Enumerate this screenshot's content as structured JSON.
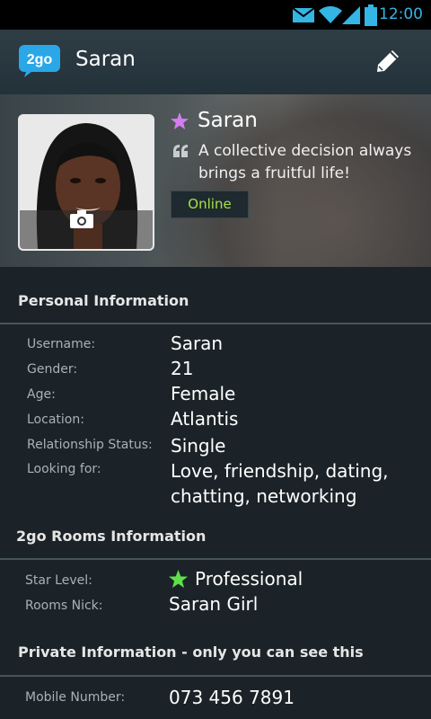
{
  "status_bar": {
    "time": "12:00",
    "icons": [
      "email-icon",
      "wifi-icon",
      "signal-icon",
      "battery-icon"
    ]
  },
  "app_bar": {
    "title": "Saran",
    "logo_text": "2go"
  },
  "profile": {
    "name": "Saran",
    "status_message": "A collective decision always brings a fruitful life!",
    "presence": "Online"
  },
  "personal": {
    "heading": "Personal Information",
    "rows": [
      {
        "label": "Username:",
        "value": "Saran"
      },
      {
        "label": "Gender:",
        "value": "21"
      },
      {
        "label": "Age:",
        "value": "Female"
      },
      {
        "label": "Location:",
        "value": "Atlantis"
      },
      {
        "label": "Relationship Status:",
        "value": "Single"
      },
      {
        "label": "Looking for:",
        "value": "Love, friendship, dating, chatting, networking"
      }
    ]
  },
  "rooms": {
    "heading": "2go Rooms Information",
    "rows": [
      {
        "label": "Star Level:",
        "value": "Professional"
      },
      {
        "label": "Rooms Nick:",
        "value": "Saran Girl"
      }
    ]
  },
  "private": {
    "heading": "Private Information - only you can see this",
    "rows": [
      {
        "label": "Mobile Number:",
        "value": "073 456 7891"
      }
    ]
  },
  "colors": {
    "accent": "#33b5e5",
    "online": "#a7e04a",
    "star_purple": "#d57cf0",
    "star_green": "#5fe04a"
  }
}
